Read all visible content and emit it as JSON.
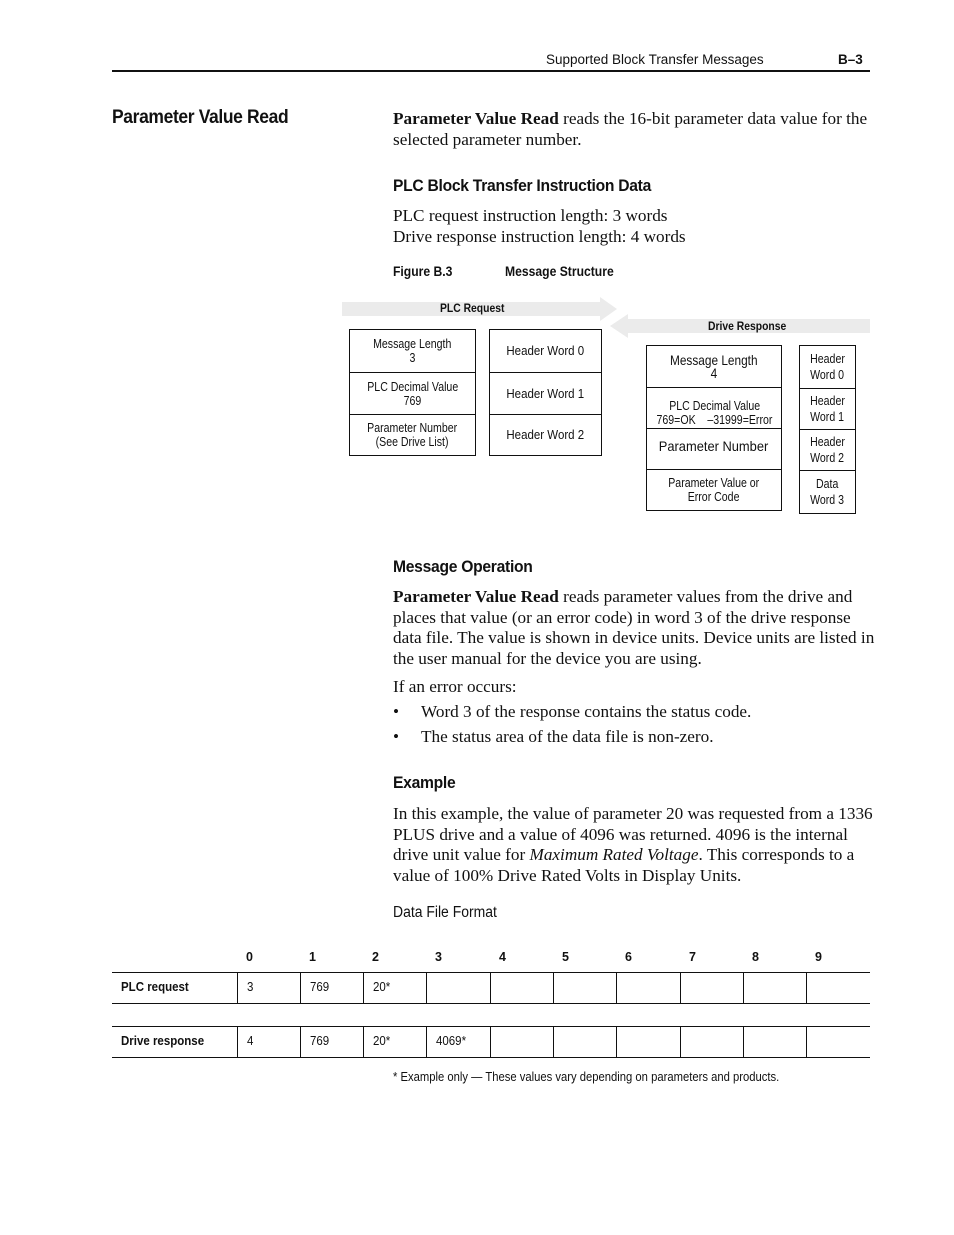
{
  "header": {
    "running_title": "Supported Block Transfer Messages",
    "page_number": "B–3"
  },
  "side_heading": "Parameter Value Read",
  "intro": {
    "bold_lead": "Parameter Value Read",
    "rest_line1": " reads the 16-bit parameter data value for the",
    "line2": "selected parameter number."
  },
  "plc_block": {
    "heading": "PLC Block Transfer Instruction Data",
    "line1": "PLC request instruction length: 3 words",
    "line2": "Drive response instruction length: 4 words"
  },
  "figure": {
    "label": "Figure B.3",
    "title": "Message Structure",
    "colors": {
      "arrow_fill": "#ebebeb",
      "box_border": "#111111"
    },
    "plc_request": {
      "arrow_label": "PLC Request",
      "data_cells": [
        {
          "line1": "Message Length",
          "line2": "3"
        },
        {
          "line1": "PLC Decimal Value",
          "line2": "769"
        },
        {
          "line1": "Parameter Number",
          "line2": "(See Drive List)"
        }
      ],
      "header_cells": [
        "Header Word 0",
        "Header Word 1",
        "Header Word 2"
      ]
    },
    "drive_response": {
      "arrow_label": "Drive Response",
      "data_cells": [
        {
          "line1": "Message Length",
          "line2": "4"
        },
        {
          "line1": "PLC Decimal Value",
          "line2": "769=OK    –31999=Error"
        },
        {
          "line1": "Parameter Number",
          "line2": ""
        },
        {
          "line1": "Parameter Value or",
          "line2": "Error Code"
        }
      ],
      "header_cells": [
        {
          "line1": "Header",
          "line2": "Word 0"
        },
        {
          "line1": "Header",
          "line2": "Word 1"
        },
        {
          "line1": "Header",
          "line2": "Word 2"
        },
        {
          "line1": "Data",
          "line2": "Word 3"
        }
      ]
    }
  },
  "message_operation": {
    "heading": "Message Operation",
    "bold_lead": "Parameter Value Read",
    "lines": [
      " reads parameter values from the drive and",
      "places that value (or an error code) in word 3 of the drive response",
      "data file. The value is shown in device units. Device units are listed in",
      "the user manual for the device you are using."
    ],
    "error_intro": "If an error occurs:",
    "bullets": [
      "Word 3 of the response contains the status code.",
      "The status area of the data file is non-zero."
    ],
    "bullet_glyph": "•"
  },
  "example": {
    "heading": "Example",
    "line1": "In this example, the value of parameter 20 was requested from a 1336",
    "line2": "PLUS drive and a value of 4096 was returned. 4096 is the internal",
    "line3_pre": "drive unit value for ",
    "line3_italic": "Maximum Rated Voltage",
    "line3_post": ". This corresponds to a",
    "line4": "value of 100% Drive Rated Volts in Display Units.",
    "table_caption": "Data File Format"
  },
  "data_table": {
    "columns": [
      "0",
      "1",
      "2",
      "3",
      "4",
      "5",
      "6",
      "7",
      "8",
      "9"
    ],
    "rows": [
      {
        "label": "PLC request",
        "values": [
          "3",
          "769",
          "20*",
          "",
          "",
          "",
          "",
          "",
          "",
          ""
        ]
      },
      {
        "label": "Drive response",
        "values": [
          "4",
          "769",
          "20*",
          "4069*",
          "",
          "",
          "",
          "",
          "",
          ""
        ]
      }
    ],
    "footnote": "* Example only — These values vary depending on parameters and products."
  }
}
